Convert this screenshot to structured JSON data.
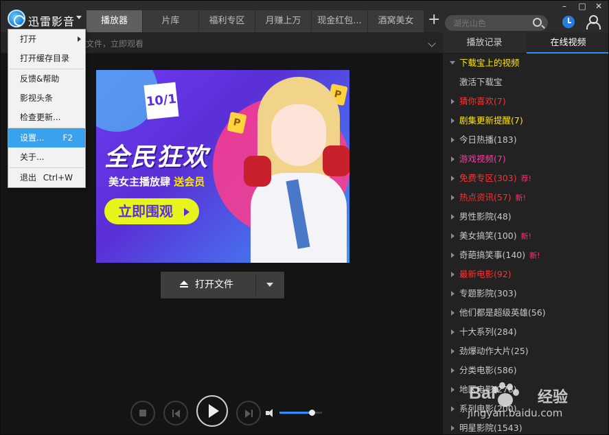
{
  "app": {
    "title": "迅雷影音"
  },
  "tabs": [
    {
      "label": "播放器",
      "active": true
    },
    {
      "label": "片库",
      "active": false
    },
    {
      "label": "福利专区",
      "active": false
    },
    {
      "label": "月赚上万",
      "active": false
    },
    {
      "label": "现金红包...",
      "active": false
    },
    {
      "label": "酒窝美女",
      "active": false
    }
  ],
  "toolbar": {
    "new_tab": "+"
  },
  "search": {
    "placeholder": "湖光山色"
  },
  "window_controls": {
    "minimize": "–",
    "maximize": "□",
    "close": "✕"
  },
  "subbar": {
    "hint": "文件，立即观看"
  },
  "banner": {
    "date_badge": "10/1",
    "headline": "全民狂欢",
    "sub_text": "美女主播放肆",
    "sub_highlight": "送会员",
    "cta": "立即围观"
  },
  "open_file": {
    "label": "打开文件"
  },
  "controls": {
    "volume_level": 0.75
  },
  "menu": {
    "items": [
      {
        "label": "打开",
        "shortcut": "",
        "submenu": true
      },
      {
        "label": "打开缓存目录",
        "shortcut": ""
      },
      {
        "label": "反馈&帮助",
        "shortcut": ""
      },
      {
        "label": "影视头条",
        "shortcut": ""
      },
      {
        "label": "检查更新...",
        "shortcut": ""
      },
      {
        "label": "设置...",
        "shortcut": "F2",
        "selected": true
      },
      {
        "label": "关于...",
        "shortcut": ""
      },
      {
        "label": "退出",
        "shortcut": "Ctrl+W"
      }
    ]
  },
  "right_panel": {
    "tabs": [
      {
        "label": "播放记录",
        "active": false
      },
      {
        "label": "在线视频",
        "active": true
      }
    ],
    "items": [
      {
        "label": "下载宝上的视频",
        "color": "#ffe600",
        "expanded": true,
        "tag": ""
      },
      {
        "label": "激活下载宝",
        "color": "#c8c8c8",
        "child": true,
        "tag": ""
      },
      {
        "label": "猜你喜欢(7)",
        "color": "#ff3030",
        "tag": ""
      },
      {
        "label": "剧集更新提醒(7)",
        "color": "#ffe600",
        "tag": ""
      },
      {
        "label": "今日热播(183)",
        "color": "#c8c8c8",
        "tag": ""
      },
      {
        "label": "游戏视频(7)",
        "color": "#ff3aa8",
        "tag": ""
      },
      {
        "label": "免费专区(303)",
        "color": "#ff3030",
        "tag": "荐!"
      },
      {
        "label": "热点资讯(57)",
        "color": "#ff3030",
        "tag": "新!"
      },
      {
        "label": "男性影院(48)",
        "color": "#c8c8c8",
        "tag": ""
      },
      {
        "label": "美女搞笑(100)",
        "color": "#c8c8c8",
        "tag": "新!"
      },
      {
        "label": "奇葩搞笑事(140)",
        "color": "#c8c8c8",
        "tag": "新!"
      },
      {
        "label": "最新电影(92)",
        "color": "#ff3030",
        "tag": ""
      },
      {
        "label": "专题影院(303)",
        "color": "#c8c8c8",
        "tag": ""
      },
      {
        "label": "他们都是超级英雄(56)",
        "color": "#c8c8c8",
        "tag": ""
      },
      {
        "label": "十大系列(284)",
        "color": "#c8c8c8",
        "tag": ""
      },
      {
        "label": "劲爆动作大片(25)",
        "color": "#c8c8c8",
        "tag": ""
      },
      {
        "label": "分类电影(586)",
        "color": "#c8c8c8",
        "tag": ""
      },
      {
        "label": "地区电影(276)",
        "color": "#c8c8c8",
        "tag": ""
      },
      {
        "label": "系列电影(200)",
        "color": "#c8c8c8",
        "tag": ""
      },
      {
        "label": "明星影院(1543)",
        "color": "#c8c8c8",
        "tag": ""
      }
    ]
  },
  "watermark": {
    "brand": "Bai",
    "brand2": "经验",
    "url": "jingyan.baidu.com"
  }
}
